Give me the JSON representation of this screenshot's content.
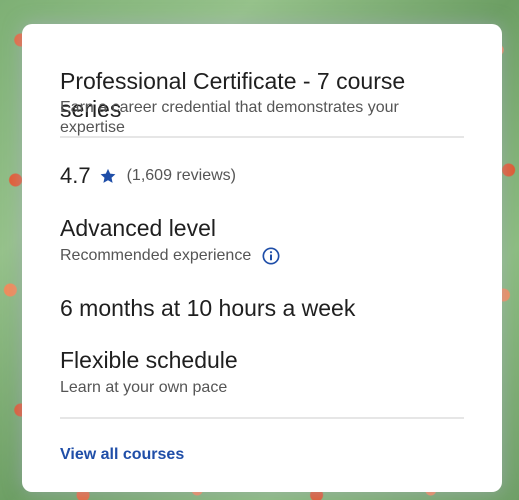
{
  "card": {
    "title": "Professional Certificate - 7 course series",
    "subtitle": "Earn a career credential that demonstrates your expertise",
    "rating": {
      "value": "4.7",
      "reviews": "(1,609 reviews)",
      "star_icon": "star-icon",
      "star_color": "#1f4ea8"
    },
    "level": {
      "title": "Advanced level",
      "subtitle": "Recommended experience",
      "info_icon": "info-icon",
      "info_color": "#1f4ea8"
    },
    "duration": "6 months at 10 hours a week",
    "schedule": {
      "title": "Flexible schedule",
      "subtitle": "Learn at your own pace"
    },
    "link": {
      "label": "View all courses",
      "color": "#1f4ea8"
    }
  }
}
